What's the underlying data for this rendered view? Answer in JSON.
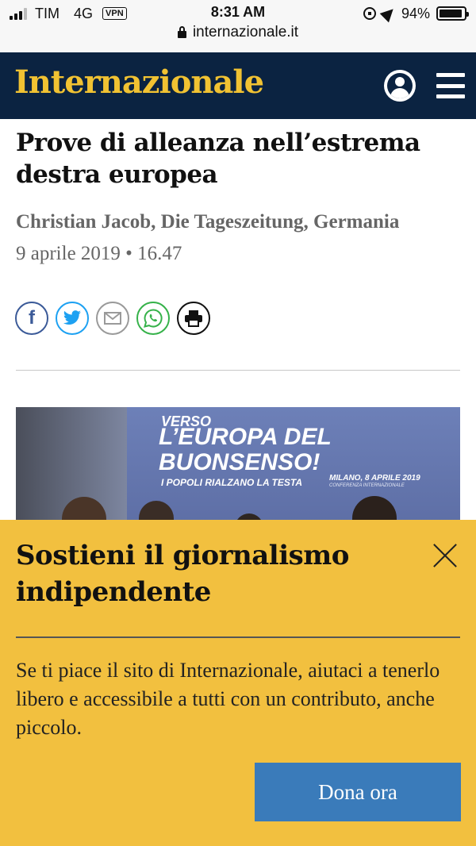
{
  "status_bar": {
    "carrier": "TIM",
    "network": "4G",
    "vpn": "VPN",
    "time": "8:31 AM",
    "battery_percent": "94%",
    "battery_level": 0.94,
    "url": "internazionale.it",
    "icons": [
      "signal-icon",
      "vpn-icon",
      "orientation-lock-icon",
      "location-icon",
      "battery-icon",
      "padlock-icon"
    ]
  },
  "header": {
    "logo": "Internazionale",
    "icons": [
      "account-icon",
      "menu-icon"
    ],
    "colors": {
      "background": "#0b2341",
      "logo": "#f1c232"
    }
  },
  "article": {
    "title": "Prove di alleanza nell’estrema destra europea",
    "byline": "Christian Jacob, Die Tageszeitung, Germania",
    "date": "9 aprile 2019 • 16.47",
    "share": {
      "facebook": "f",
      "icons": [
        "facebook-icon",
        "twitter-icon",
        "mail-icon",
        "whatsapp-icon",
        "print-icon"
      ]
    },
    "photo": {
      "line1": "VERSO",
      "line2": "L’EUROPA DEL BUONSENSO!",
      "line3": "I POPOLI RIALZANO LA TESTA",
      "line4": "MILANO, 8 APRILE 2019",
      "line5": "CONFERENZA INTERNAZIONALE"
    }
  },
  "donation": {
    "title": "Sostieni il giornalismo indipendente",
    "body": "Se ti piace il sito di Internazionale, aiutaci a tenerlo libero e accessibile a tutti con un contributo, anche piccolo.",
    "button": "Dona ora",
    "colors": {
      "background": "#f2c03f",
      "button": "#3a7bba"
    }
  }
}
